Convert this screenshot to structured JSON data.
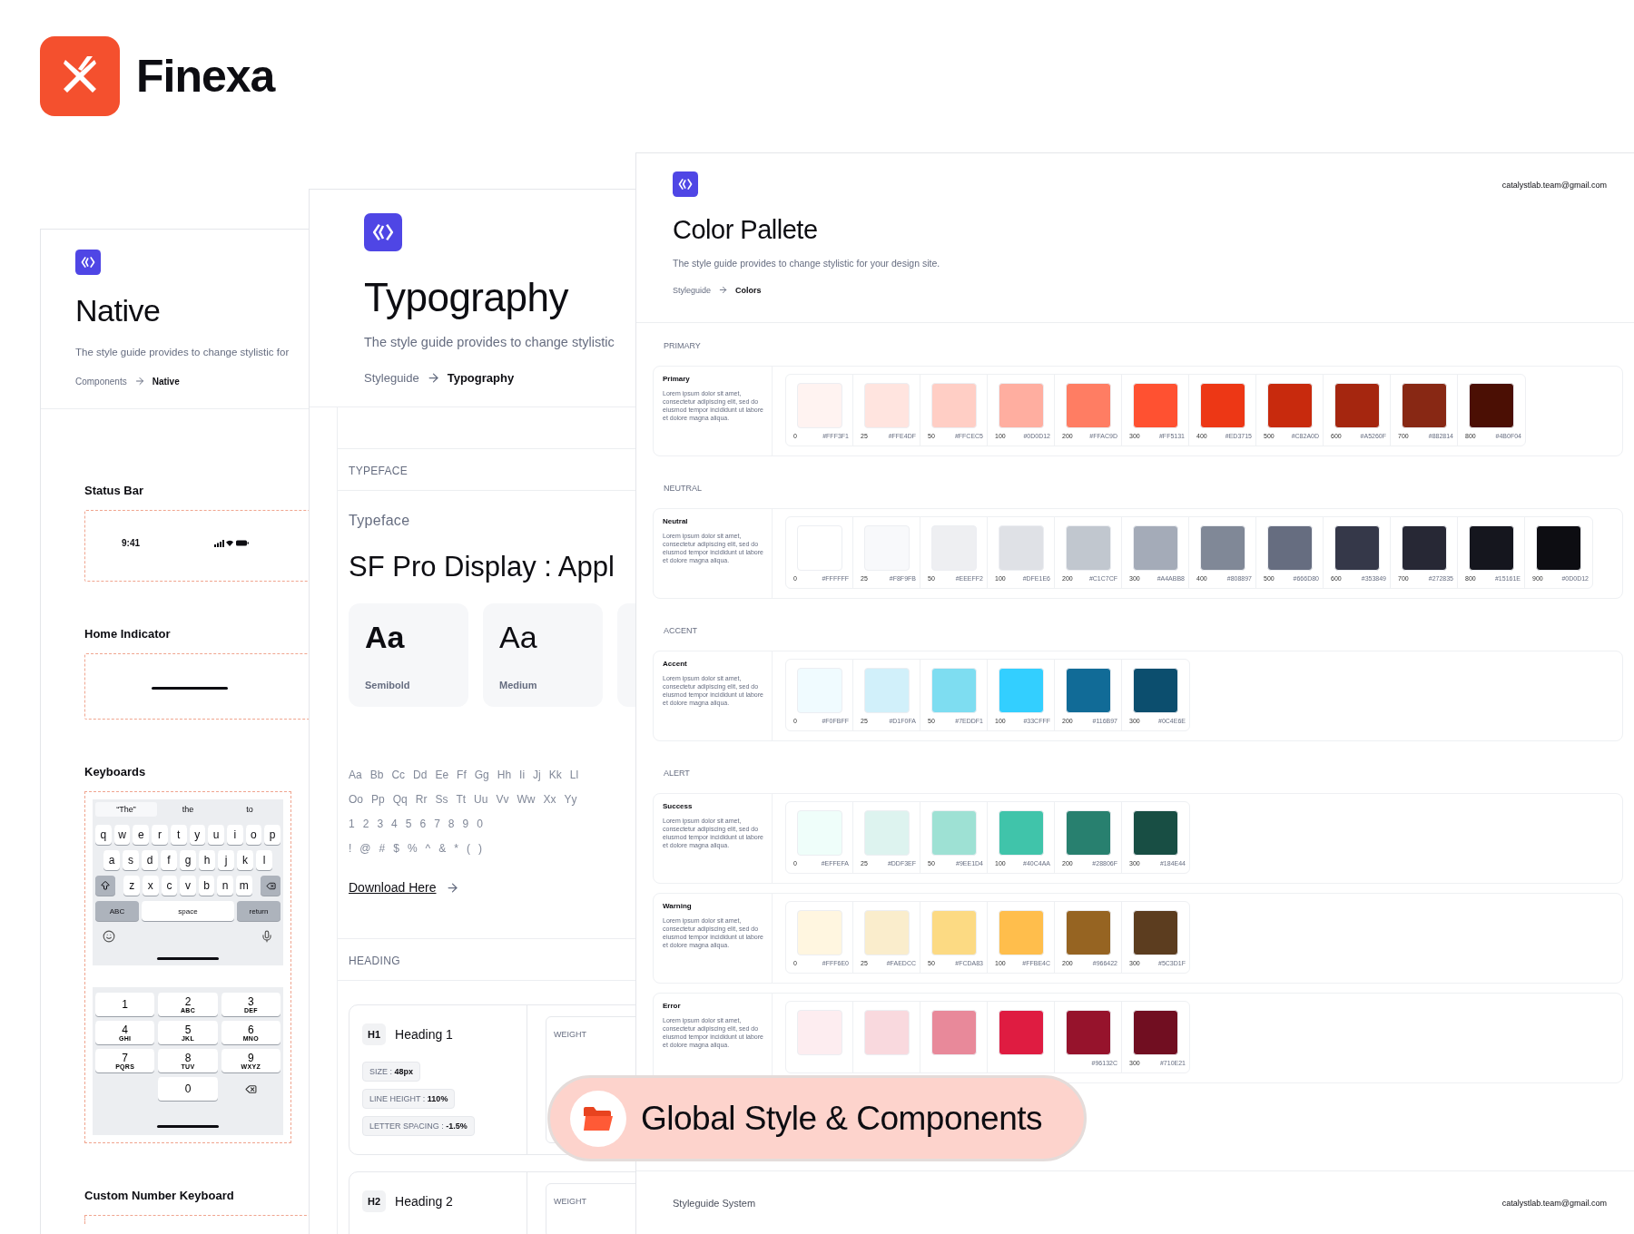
{
  "brand": {
    "name": "Finexa"
  },
  "native": {
    "title": "Native",
    "description": "The style guide provides to change stylistic for",
    "breadcrumb": {
      "parent": "Components",
      "current": "Native"
    },
    "sections": [
      {
        "kind": "status_bar",
        "title": "Status Bar",
        "time": "9:41"
      },
      {
        "kind": "home_indicator",
        "title": "Home Indicator"
      },
      {
        "kind": "keyboards",
        "title": "Keyboards",
        "suggestions": [
          "“The”",
          "the",
          "to"
        ],
        "letter_rows": [
          [
            "q",
            "w",
            "e",
            "r",
            "t",
            "y",
            "u",
            "i",
            "o",
            "p"
          ],
          [
            "a",
            "s",
            "d",
            "f",
            "g",
            "h",
            "j",
            "k",
            "l"
          ],
          [
            "z",
            "x",
            "c",
            "v",
            "b",
            "n",
            "m"
          ]
        ],
        "bottom_keys": [
          "ABC",
          "space",
          "return"
        ],
        "number_keys": [
          {
            "digit": "1"
          },
          {
            "digit": "2",
            "letters": "ABC"
          },
          {
            "digit": "3",
            "letters": "DEF"
          },
          {
            "digit": "4",
            "letters": "GHI"
          },
          {
            "digit": "5",
            "letters": "JKL"
          },
          {
            "digit": "6",
            "letters": "MNO"
          },
          {
            "digit": "7",
            "letters": "PQRS"
          },
          {
            "digit": "8",
            "letters": "TUV"
          },
          {
            "digit": "9",
            "letters": "WXYZ"
          },
          {
            "digit": "0"
          }
        ]
      },
      {
        "kind": "custom_keyboard",
        "title": "Custom Number Keyboard"
      }
    ]
  },
  "typography": {
    "title": "Typography",
    "description": "The style guide provides to change stylistic",
    "breadcrumb": {
      "parent": "Styleguide",
      "current": "Typography"
    },
    "typeface_section": "TYPEFACE",
    "typeface_label": "Typeface",
    "font_name": "SF Pro Display : Appl",
    "weights": [
      {
        "sample": "Aa",
        "name": "Semibold"
      },
      {
        "sample": "Aa",
        "name": "Medium"
      }
    ],
    "glyph_rows": [
      [
        "Aa",
        "Bb",
        "Cc",
        "Dd",
        "Ee",
        "Ff",
        "Gg",
        "Hh",
        "Ii",
        "Jj",
        "Kk",
        "Ll"
      ],
      [
        "Oo",
        "Pp",
        "Qq",
        "Rr",
        "Ss",
        "Tt",
        "Uu",
        "Vv",
        "Ww",
        "Xx",
        "Yy"
      ],
      [
        "1",
        "2",
        "3",
        "4",
        "5",
        "6",
        "7",
        "8",
        "9",
        "0"
      ],
      [
        "!",
        "@",
        "#",
        "$",
        "%",
        "^",
        "&",
        "*",
        "(",
        ")"
      ]
    ],
    "download": "Download Here",
    "heading_section": "HEADING",
    "headings": [
      {
        "tag": "H1",
        "name": "Heading 1",
        "specs": [
          "SIZE : **48px**",
          "LINE HEIGHT : **110%**",
          "LETTER SPACING : **-1.5%**"
        ],
        "weight_label": "WEIGHT"
      },
      {
        "tag": "H2",
        "name": "Heading 2",
        "weight_label": "WEIGHT"
      }
    ]
  },
  "palette": {
    "email": "catalystlab.team@gmail.com",
    "title": "Color Pallete",
    "description": "The style guide provides to change stylistic for your design site.",
    "breadcrumb": {
      "parent": "Styleguide",
      "current": "Colors"
    },
    "groups": [
      {
        "label": "PRIMARY",
        "scales": [
          {
            "name": "Primary",
            "description": "Lorem ipsum dolor sit amet, consectetur adipiscing elit, sed do eiusmod tempor incididunt ut labore et dolore magna aliqua.",
            "swatches": [
              {
                "step": "0",
                "hex": "#FFF3F1",
                "color": "#fff3f1"
              },
              {
                "step": "25",
                "hex": "#FFE4DF",
                "color": "#ffe4df"
              },
              {
                "step": "50",
                "hex": "#FFCEC5",
                "color": "#ffcec5"
              },
              {
                "step": "100",
                "hex": "#0D0D12",
                "color": "#ffaea0"
              },
              {
                "step": "200",
                "hex": "#FFAC9D",
                "color": "#ff7d63"
              },
              {
                "step": "300",
                "hex": "#FF5131",
                "color": "#ff5131"
              },
              {
                "step": "400",
                "hex": "#ED3715",
                "color": "#ed3715"
              },
              {
                "step": "500",
                "hex": "#C82A0D",
                "color": "#c82a0d"
              },
              {
                "step": "600",
                "hex": "#A5260F",
                "color": "#a5260f"
              },
              {
                "step": "700",
                "hex": "#882814",
                "color": "#882814"
              },
              {
                "step": "800",
                "hex": "#4B0F04",
                "color": "#4b0f04"
              }
            ]
          }
        ]
      },
      {
        "label": "NEUTRAL",
        "scales": [
          {
            "name": "Neutral",
            "description": "Lorem ipsum dolor sit amet, consectetur adipiscing elit, sed do eiusmod tempor incididunt ut labore et dolore magna aliqua.",
            "swatches": [
              {
                "step": "0",
                "hex": "#FFFFFF",
                "color": "#ffffff"
              },
              {
                "step": "25",
                "hex": "#F8F9FB",
                "color": "#f8f9fb"
              },
              {
                "step": "50",
                "hex": "#EEEFF2",
                "color": "#eeeff2"
              },
              {
                "step": "100",
                "hex": "#DFE1E6",
                "color": "#dfe1e6"
              },
              {
                "step": "200",
                "hex": "#C1C7CF",
                "color": "#c1c7cf"
              },
              {
                "step": "300",
                "hex": "#A4ABB8",
                "color": "#a4abb8"
              },
              {
                "step": "400",
                "hex": "#808897",
                "color": "#808897"
              },
              {
                "step": "500",
                "hex": "#666D80",
                "color": "#666d80"
              },
              {
                "step": "600",
                "hex": "#353849",
                "color": "#353849"
              },
              {
                "step": "700",
                "hex": "#272835",
                "color": "#272835"
              },
              {
                "step": "800",
                "hex": "#15161E",
                "color": "#15161e"
              },
              {
                "step": "900",
                "hex": "#0D0D12",
                "color": "#0d0d12"
              }
            ]
          }
        ]
      },
      {
        "label": "ACCENT",
        "scales": [
          {
            "name": "Accent",
            "description": "Lorem ipsum dolor sit amet, consectetur adipiscing elit, sed do eiusmod tempor incididunt ut labore et dolore magna aliqua.",
            "swatches": [
              {
                "step": "0",
                "hex": "#F0FBFF",
                "color": "#f0fbff"
              },
              {
                "step": "25",
                "hex": "#D1F0FA",
                "color": "#d1f0fa"
              },
              {
                "step": "50",
                "hex": "#7EDDF1",
                "color": "#7eddf1"
              },
              {
                "step": "100",
                "hex": "#33CFFF",
                "color": "#33cfff"
              },
              {
                "step": "200",
                "hex": "#116B97",
                "color": "#116b97"
              },
              {
                "step": "300",
                "hex": "#0C4E6E",
                "color": "#0c4e6e"
              }
            ]
          }
        ]
      },
      {
        "label": "ALERT",
        "scales": [
          {
            "name": "Success",
            "description": "Lorem ipsum dolor sit amet, consectetur adipiscing elit, sed do eiusmod tempor incididunt ut labore et dolore magna aliqua.",
            "swatches": [
              {
                "step": "0",
                "hex": "#EFFEFA",
                "color": "#effefa"
              },
              {
                "step": "25",
                "hex": "#DDF3EF",
                "color": "#ddf3ef"
              },
              {
                "step": "50",
                "hex": "#9EE1D4",
                "color": "#9ee1d4"
              },
              {
                "step": "100",
                "hex": "#40C4AA",
                "color": "#40c4aa"
              },
              {
                "step": "200",
                "hex": "#28806F",
                "color": "#28806f"
              },
              {
                "step": "300",
                "hex": "#184E44",
                "color": "#184e44"
              }
            ]
          },
          {
            "name": "Warning",
            "description": "Lorem ipsum dolor sit amet, consectetur adipiscing elit, sed do eiusmod tempor incididunt ut labore et dolore magna aliqua.",
            "swatches": [
              {
                "step": "0",
                "hex": "#FFF6E0",
                "color": "#fff6e0"
              },
              {
                "step": "25",
                "hex": "#FAEDCC",
                "color": "#faedcc"
              },
              {
                "step": "50",
                "hex": "#FCDA83",
                "color": "#fcda83"
              },
              {
                "step": "100",
                "hex": "#FFBE4C",
                "color": "#ffbe4c"
              },
              {
                "step": "200",
                "hex": "#966422",
                "color": "#966422"
              },
              {
                "step": "300",
                "hex": "#5C3D1F",
                "color": "#5c3d1f"
              }
            ]
          },
          {
            "name": "Error",
            "description": "Lorem ipsum dolor sit amet, consectetur adipiscing elit, sed do eiusmod tempor incididunt ut labore et dolore magna aliqua.",
            "swatches": [
              {
                "color": "#fdedf0"
              },
              {
                "color": "#f9d9de"
              },
              {
                "color": "#e8899a"
              },
              {
                "color": "#df1c41"
              },
              {
                "hex": "#96132C",
                "color": "#96132c"
              },
              {
                "step": "300",
                "hex": "#710E21",
                "color": "#710e21"
              }
            ]
          }
        ]
      }
    ],
    "footer": {
      "label": "Styleguide System",
      "email": "catalystlab.team@gmail.com"
    }
  },
  "badge": {
    "label": "Global Style & Components"
  }
}
